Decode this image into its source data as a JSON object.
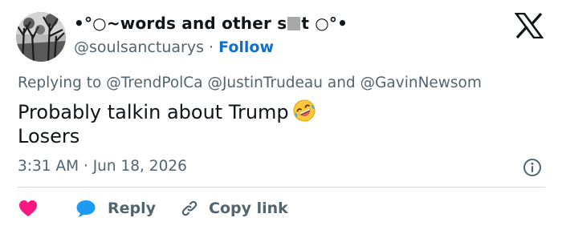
{
  "author": {
    "name_prefix": "•°○~words and other s",
    "name_suffix": "t ○°•",
    "handle": "@soulsanctuarys",
    "separator": "·",
    "follow_label": "Follow"
  },
  "reply_context": {
    "label": "Replying to",
    "mentions": [
      "@TrendPolCa",
      "@JustinTrudeau",
      "@GavinNewsom"
    ],
    "conjunction": "and"
  },
  "tweet": {
    "line1": "Probably talkin about Trump",
    "emoji": "rolling-on-floor-laughing-emoji",
    "line2": "Losers"
  },
  "meta": {
    "time": "3:31 AM",
    "separator": "·",
    "date": "Jun 18, 2026"
  },
  "actions": {
    "reply_label": "Reply",
    "copy_link_label": "Copy link"
  },
  "icons": {
    "like": "heart-icon",
    "reply": "speech-bubble-icon",
    "copy": "link-icon",
    "info": "info-icon",
    "brand": "x-logo-icon"
  },
  "colors": {
    "like": "#f91880",
    "reply": "#1d9bf0",
    "follow": "#0f6fcf",
    "muted": "#536471",
    "text": "#0f1419"
  }
}
